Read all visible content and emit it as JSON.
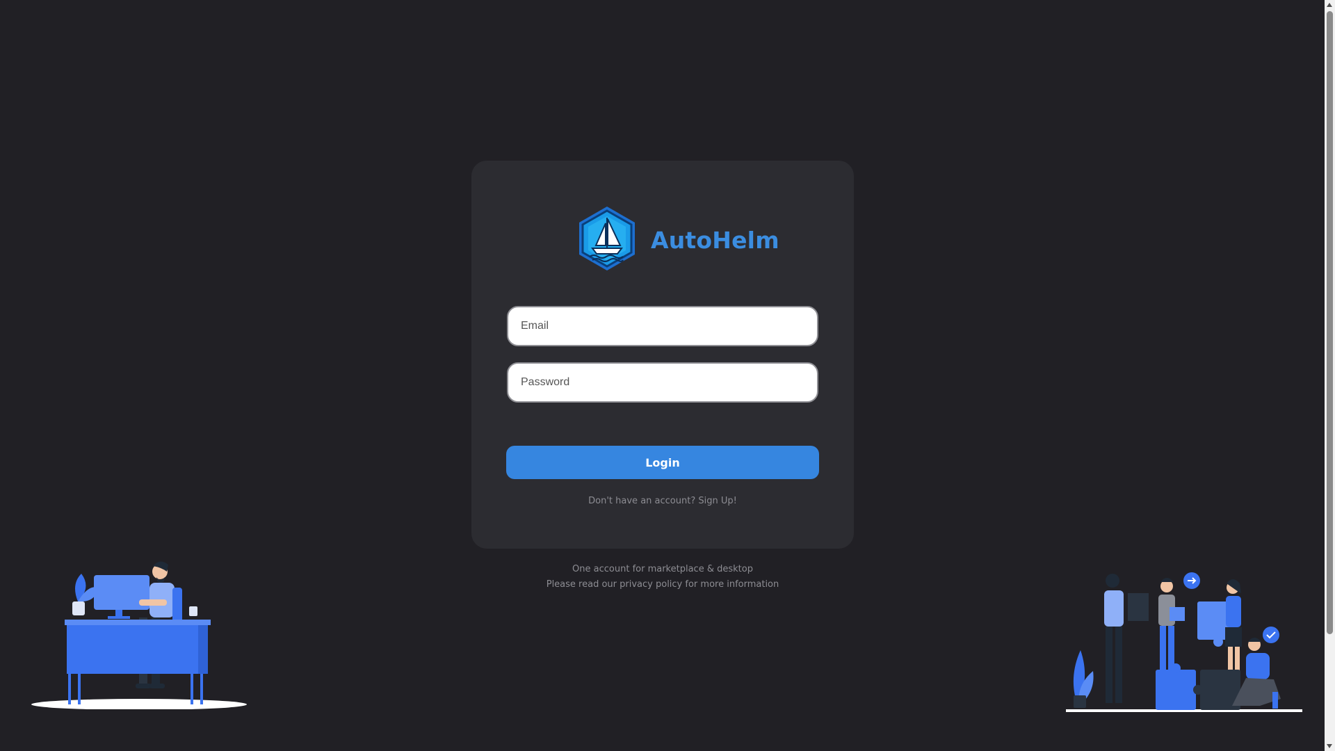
{
  "app": {
    "name": "AutoHelm",
    "logo_icon": "sailboat-hexagon-icon"
  },
  "login_form": {
    "email_placeholder": "Email",
    "email_value": "",
    "password_placeholder": "Password",
    "password_value": "",
    "login_label": "Login",
    "signup_prompt": "Don't have an account?",
    "signup_link": "Sign Up!"
  },
  "footer": {
    "line1": "One account for marketplace & desktop",
    "line2_before": "Please read our",
    "privacy_link": "privacy policy",
    "line2_after": "for more information"
  },
  "colors": {
    "background": "#212025",
    "card": "#2c2c31",
    "accent": "#3686e0",
    "brand_text": "#3b8de0",
    "muted_text": "#8d8d93"
  },
  "illustrations": [
    "office-desk-illustration",
    "team-puzzle-illustration"
  ]
}
